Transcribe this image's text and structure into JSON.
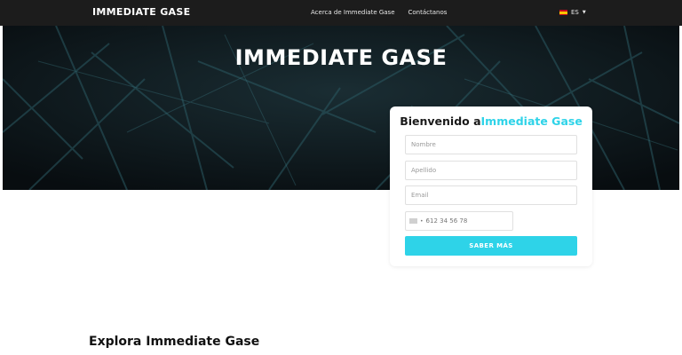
{
  "navbar": {
    "logo": "IMMEDIATE GASE",
    "links": [
      "Acerca de Immediate Gase",
      "Contáctanos"
    ],
    "language": "ES"
  },
  "hero": {
    "title": "IMMEDIATE GASE"
  },
  "form": {
    "title_prefix": "Bienvenido a",
    "title_brand": "Immediate Gase",
    "first_name_placeholder": "Nombre",
    "last_name_placeholder": "Apellido",
    "email_placeholder": "Email",
    "phone_placeholder": "612 34 56 78",
    "submit_label": "SABER MÁS"
  },
  "section": {
    "title": "Explora Immediate Gase"
  },
  "colors": {
    "accent": "#2ed3e8",
    "navbar_bg": "#1c1c1c",
    "hero_bg": "#0c1419"
  }
}
